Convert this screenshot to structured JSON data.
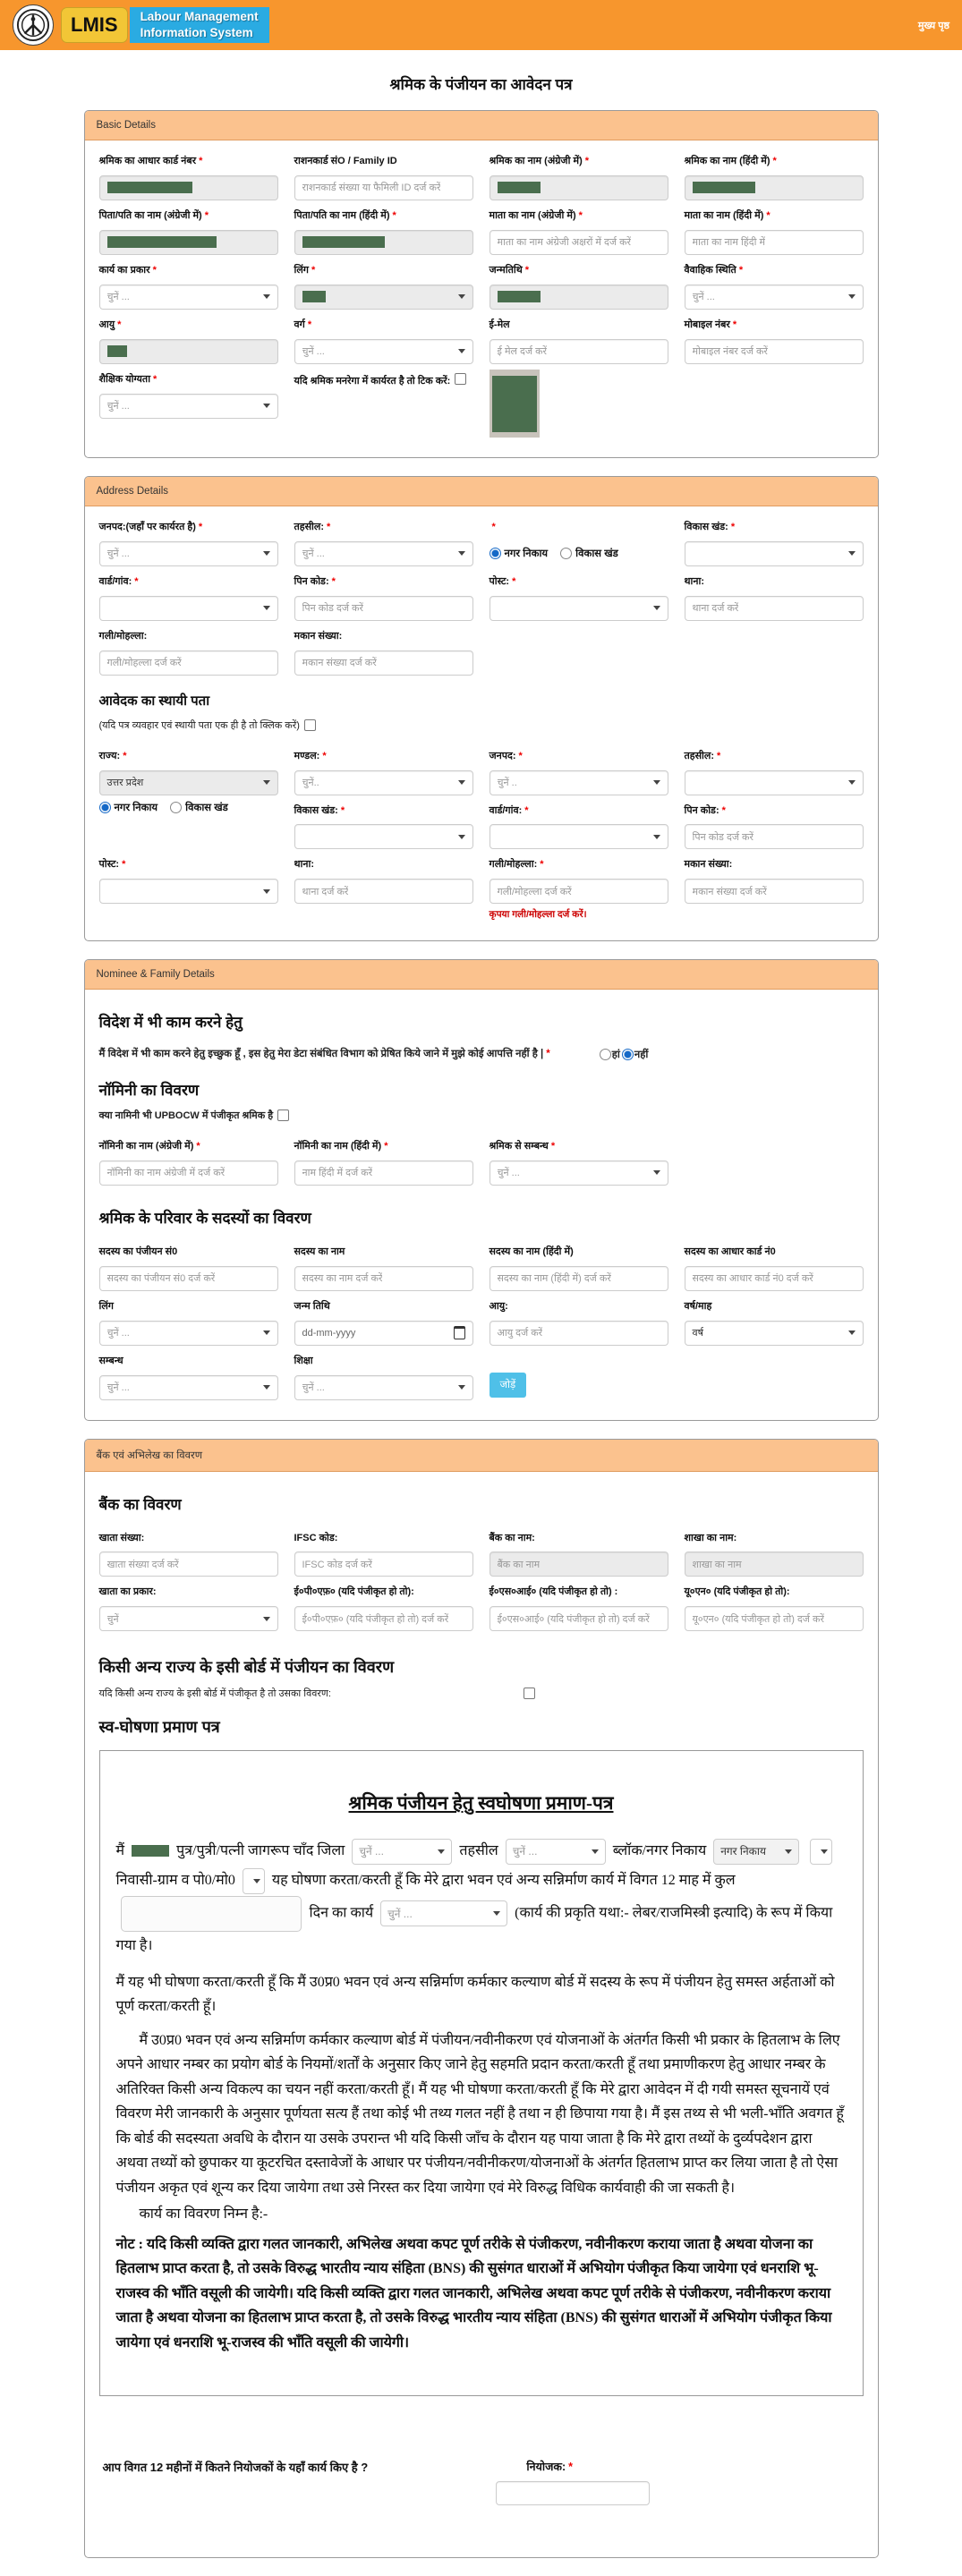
{
  "header": {
    "logo_text": "LMIS",
    "app_line1": "Labour Management",
    "app_line2": "Information System",
    "home_link": "मुख्य पृष्ठ",
    "header_color": "#F7962D",
    "banner_blue": "#2AABE2",
    "badge_yellow": "#F2C636"
  },
  "page_title": "श्रमिक के पंजीयन का आवेदन पत्र",
  "theme": {
    "section_header_bg": "#FBC28E",
    "redaction_green": "#4A6E4E",
    "add_button_blue": "#4FC0E8",
    "error_red": "#cc0000"
  },
  "basic": {
    "title": "Basic Details",
    "rows": [
      [
        {
          "name": "aadhaar-number",
          "label": "श्रमिक का आधार कार्ड नंबर",
          "required": true,
          "kind": "filled",
          "redact_w": 95
        },
        {
          "name": "ration-card",
          "label": "राशनकार्ड संO / Family ID",
          "kind": "input",
          "placeholder": "राशनकार्ड संख्या या फैमिली ID दर्ज करें"
        },
        {
          "name": "worker-name-en",
          "label": "श्रमिक का नाम (अंग्रेजी में)",
          "required": true,
          "kind": "filled",
          "redact_w": 48
        },
        {
          "name": "worker-name-hi",
          "label": "श्रमिक का नाम (हिंदी में)",
          "required": true,
          "kind": "filled",
          "redact_w": 70
        }
      ],
      [
        {
          "name": "father-husband-name-en",
          "label": "पिता/पति का नाम (अंग्रेजी में)",
          "required": true,
          "kind": "filled",
          "redact_w": 122
        },
        {
          "name": "father-husband-name-hi",
          "label": "पिता/पति का नाम (हिंदी में)",
          "required": true,
          "kind": "filled",
          "redact_w": 92
        },
        {
          "name": "mother-name-en",
          "label": "माता का नाम (अंग्रेजी में)",
          "required": true,
          "kind": "input",
          "placeholder": "माता का नाम अंग्रेजी अक्षरों में दर्ज करें"
        },
        {
          "name": "mother-name-hi",
          "label": "माता का नाम (हिंदी में)",
          "required": true,
          "kind": "input",
          "placeholder": "माता का नाम हिंदी में"
        }
      ],
      [
        {
          "name": "work-type",
          "label": "कार्य का प्रकार",
          "required": true,
          "kind": "select",
          "value": "चुनें ...",
          "muted": true
        },
        {
          "name": "gender",
          "label": "लिंग",
          "required": true,
          "kind": "select-redacted",
          "redact_w": 26
        },
        {
          "name": "dob",
          "label": "जन्मतिथि",
          "required": true,
          "kind": "filled",
          "redact_w": 48
        },
        {
          "name": "marital-status",
          "label": "वैवाहिक स्थिति",
          "required": true,
          "kind": "select",
          "value": "चुनें ...",
          "muted": true
        }
      ],
      [
        {
          "name": "age",
          "label": "आयु",
          "required": true,
          "kind": "filled",
          "redact_w": 22
        },
        {
          "name": "category",
          "label": "वर्ग",
          "required": true,
          "kind": "select",
          "value": "चुनें ...",
          "muted": true
        },
        {
          "name": "email",
          "label": "ई-मेल",
          "kind": "input",
          "placeholder": "ई मेल दर्ज करें"
        },
        {
          "name": "mobile-number",
          "label": "मोबाइल नंबर",
          "required": true,
          "kind": "input",
          "placeholder": "मोबाइल नंबर दर्ज करें"
        }
      ],
      [
        {
          "name": "education",
          "label": "शैक्षिक योग्यता",
          "required": true,
          "kind": "select",
          "value": "चुनें ...",
          "muted": true
        },
        {
          "name": "mnrega-tick",
          "kind": "checktext",
          "text": "यदि श्रमिक मनरेगा में कार्यरत है तो टिक करें:"
        },
        {
          "name": "worker-photo",
          "kind": "photo"
        },
        {}
      ]
    ]
  },
  "address": {
    "title": "Address Details",
    "rows": [
      [
        {
          "name": "district-working",
          "label": "जनपद:(जहाँ पर कार्यरत है)",
          "required": true,
          "kind": "select",
          "value": "चुनें ...",
          "muted": true
        },
        {
          "name": "tehsil",
          "label": "तहसील:",
          "required": true,
          "kind": "select",
          "value": "चुनें ...",
          "muted": true
        },
        {
          "name": "body-type",
          "label": "",
          "required": true,
          "kind": "radios",
          "options": [
            {
              "name": "nagar-nikay",
              "label": "नगर निकाय",
              "checked": true
            },
            {
              "name": "vikas-khand",
              "label": "विकास खंड",
              "checked": false
            }
          ]
        },
        {
          "name": "vikas-khand",
          "label": "विकास खंड:",
          "required": true,
          "kind": "select",
          "value": ""
        }
      ],
      [
        {
          "name": "ward-village",
          "label": "वार्ड/गांव:",
          "required": true,
          "kind": "select",
          "value": ""
        },
        {
          "name": "pin-code",
          "label": "पिन कोड:",
          "required": true,
          "kind": "input",
          "placeholder": "पिन कोड दर्ज करें"
        },
        {
          "name": "post",
          "label": "पोस्ट:",
          "required": true,
          "kind": "select",
          "value": ""
        },
        {
          "name": "police-station",
          "label": "थाना:",
          "kind": "input",
          "placeholder": "थाना दर्ज करें"
        }
      ],
      [
        {
          "name": "street-mohalla",
          "label": "गली/मोहल्ला:",
          "kind": "input",
          "placeholder": "गली/मोहल्ला दर्ज करें"
        },
        {
          "name": "house-number",
          "label": "मकान संख्या:",
          "kind": "input",
          "placeholder": "मकान संख्या दर्ज करें"
        },
        {},
        {}
      ]
    ],
    "perm_heading": "आवेदक का स्थायी पता",
    "perm_note": "(यदि पत्र व्यवहार एवं स्थायी पता एक ही है तो क्लिक करें)",
    "perm_rows": [
      [
        {
          "name": "perm-state",
          "label": "राज्य:",
          "required": true,
          "kind": "select",
          "value": "उत्तर प्रदेश",
          "disabled": true
        },
        {
          "name": "perm-mandal",
          "label": "मण्डल:",
          "required": true,
          "kind": "select",
          "value": "चुनें..",
          "muted": true
        },
        {
          "name": "perm-district",
          "label": "जनपद:",
          "required": true,
          "kind": "select",
          "value": "चुनें ..",
          "muted": true
        },
        {
          "name": "perm-tehsil",
          "label": "तहसील:",
          "required": true,
          "kind": "select",
          "value": ""
        }
      ],
      [
        {
          "name": "perm-body-type",
          "kind": "radios",
          "options": [
            {
              "name": "perm-nagar-nikay",
              "label": "नगर निकाय",
              "checked": true
            },
            {
              "name": "perm-vikas-khand",
              "label": "विकास खंड",
              "checked": false
            }
          ]
        },
        {
          "name": "perm-vikas-khand",
          "label": "विकास खंड:",
          "required": true,
          "kind": "select",
          "value": ""
        },
        {
          "name": "perm-ward-village",
          "label": "वार्ड/गांव:",
          "required": true,
          "kind": "select",
          "value": ""
        },
        {
          "name": "perm-pin-code",
          "label": "पिन कोड:",
          "required": true,
          "kind": "input",
          "placeholder": "पिन कोड दर्ज करें"
        }
      ],
      [
        {
          "name": "perm-post",
          "label": "पोस्ट:",
          "required": true,
          "kind": "select",
          "value": ""
        },
        {
          "name": "perm-police-station",
          "label": "थाना:",
          "kind": "input",
          "placeholder": "थाना दर्ज करें"
        },
        {
          "name": "perm-street-mohalla",
          "label": "गली/मोहल्ला:",
          "required": true,
          "kind": "input",
          "placeholder": "गली/मोहल्ला दर्ज करें",
          "error": "कृपया गली/मोहल्ला दर्ज करें।"
        },
        {
          "name": "perm-house-number",
          "label": "मकान संख्या:",
          "kind": "input",
          "placeholder": "मकान संख्या दर्ज करें"
        }
      ]
    ]
  },
  "nominee": {
    "title": "Nominee & Family Details",
    "foreign_heading": "विदेश में भी काम करने हेतु",
    "foreign_text": "मैं विदेश में भी काम करने हेतु इच्छुक हूँ , इस हेतु मेरा डेटा संबंधित विभाग को प्रेषित किये जाने में मुझे कोई आपत्ति नहीं है |",
    "consent_yes": "हां",
    "consent_no": "नहीं",
    "nominee_heading": "नॉमिनी का विवरण",
    "upbocw_note": "क्या नामिनी भी UPBOCW में पंजीकृत श्रमिक है",
    "rows": [
      [
        {
          "name": "nominee-name-en",
          "label": "नॉमिनी का नाम (अंग्रेजी में)",
          "required": true,
          "kind": "input",
          "placeholder": "नॉमिनी का नाम अंग्रेजी में दर्ज करें"
        },
        {
          "name": "nominee-name-hi",
          "label": "नॉमिनी का नाम (हिंदी में)",
          "required": true,
          "kind": "input",
          "placeholder": "नाम हिंदी में दर्ज करें"
        },
        {
          "name": "relation-with-worker",
          "label": "श्रमिक से सम्बन्ध",
          "required": true,
          "kind": "select",
          "value": "चुनें ...",
          "muted": true
        },
        {}
      ]
    ],
    "family_heading": "श्रमिक के परिवार के सदस्यों का विवरण",
    "family_rows": [
      [
        {
          "name": "member-reg-no",
          "label": "सदस्य का पंजीयन सं0",
          "kind": "input",
          "placeholder": "सदस्य का पंजीयन सं0 दर्ज करें"
        },
        {
          "name": "member-name",
          "label": "सदस्य का नाम",
          "kind": "input",
          "placeholder": "सदस्य का नाम दर्ज करें"
        },
        {
          "name": "member-name-hi",
          "label": "सदस्य का नाम (हिंदी में)",
          "kind": "input",
          "placeholder": "सदस्य का नाम (हिंदी में) दर्ज करें"
        },
        {
          "name": "member-aadhaar",
          "label": "सदस्य का आधार कार्ड नं0",
          "kind": "input",
          "placeholder": "सदस्य का आधार कार्ड नं0 दर्ज करें"
        }
      ],
      [
        {
          "name": "member-gender",
          "label": "लिंग",
          "kind": "select",
          "value": "चुनें ...",
          "muted": true
        },
        {
          "name": "member-dob",
          "label": "जन्म तिथि",
          "kind": "date",
          "value": "dd-mm-yyyy"
        },
        {
          "name": "member-age",
          "label": "आयु:",
          "kind": "input",
          "placeholder": "आयु दर्ज करें"
        },
        {
          "name": "member-year-month",
          "label": "वर्ष/माह",
          "kind": "select",
          "value": "वर्ष"
        }
      ],
      [
        {
          "name": "member-relation",
          "label": "सम्बन्ध",
          "kind": "select",
          "value": "चुनें ...",
          "muted": true
        },
        {
          "name": "member-education",
          "label": "शिक्षा",
          "kind": "select",
          "value": "चुनें ...",
          "muted": true
        },
        {
          "name": "add-member-button",
          "label": "",
          "kind": "button",
          "value": "जोड़ें"
        },
        {}
      ]
    ]
  },
  "bank": {
    "title": "बैंक एवं अभिलेख का विवरण",
    "bank_heading": "बैंक का विवरण",
    "rows": [
      [
        {
          "name": "account-number",
          "label": "खाता संख्या:",
          "kind": "input",
          "placeholder": "खाता संख्या दर्ज करें"
        },
        {
          "name": "ifsc-code",
          "label": "IFSC कोड:",
          "kind": "input",
          "placeholder": "IFSC कोड दर्ज करें"
        },
        {
          "name": "bank-name",
          "label": "बैंक का नाम:",
          "kind": "input",
          "placeholder": "बैंक का नाम",
          "disabled": true
        },
        {
          "name": "branch-name",
          "label": "शाखा का नाम:",
          "kind": "input",
          "placeholder": "शाखा का नाम",
          "disabled": true
        }
      ],
      [
        {
          "name": "account-type",
          "label": "खाता का प्रकार:",
          "kind": "select",
          "value": "चुनें",
          "muted": true
        },
        {
          "name": "epf-number",
          "label": "ई०पी०एफ़० (यदि पंजीकृत हो तो):",
          "kind": "input",
          "placeholder": "ई०पी०एफ़० (यदि पंजीकृत हो तो) दर्ज करें"
        },
        {
          "name": "esi-number",
          "label": "ई०एस०आई० (यदि पंजीकृत हो तो) :",
          "kind": "input",
          "placeholder": "ई०एस०आई० (यदि पंजीकृत हो तो) दर्ज करें"
        },
        {
          "name": "un-number",
          "label": "यू०एन० (यदि पंजीकृत हो तो):",
          "kind": "input",
          "placeholder": "यू०एन० (यदि पंजीकृत हो तो) दर्ज करें"
        }
      ]
    ],
    "other_state_heading": "किसी अन्य राज्य के इसी बोर्ड में पंजीयन का विवरण",
    "other_state_note": "यदि किसी अन्य राज्य के इसी बोर्ड में पंजीकृत है तो उसका विवरण:",
    "self_decl_heading": "स्व-घोषणा प्रमाण पत्र"
  },
  "decl": {
    "title": "श्रमिक पंजीयन हेतु स्वघोषणा प्रमाण-पत्र",
    "s1": "मैं",
    "s2": "पुत्र/पुत्री/पत्नी जागरूप चाँद जिला",
    "s3": "तहसील",
    "s4": "ब्लॉक/नगर निकाय",
    "block_value": "नगर निकाय",
    "s5": "निवासी-ग्राम व पो0/मो0",
    "s6": "यह घोषणा करता/करती हूँ कि मेरे द्वारा भवन एवं अन्य सन्निर्माण कार्य में विगत 12 माह में कुल",
    "s7": "दिन का कार्य",
    "s8": "(कार्य की प्रकृति यथा:- लेबर/राजमिस्त्री इत्यादि) के रूप में किया गया है।",
    "choose": "चुनें ...",
    "p1": "मैं यह भी घोषणा करता/करती हूँ कि मैं उ0प्र0 भवन एवं अन्य सन्निर्माण कर्मकार कल्याण बोर्ड में सदस्य के रूप में पंजीयन हेतु समस्त अर्हताओं को पूर्ण करता/करती हूँ।",
    "p2": "मैं उ0प्र0 भवन एवं अन्य सन्निर्माण कर्मकार कल्याण बोर्ड में पंजीयन/नवीनीकरण एवं योजनाओं के अंतर्गत किसी भी प्रकार के हितलाभ के लिए अपने आधार नम्बर का प्रयोग बोर्ड के नियमों/शर्तों के अनुसार किए जाने हेतु सहमति प्रदान करता/करती हूँ तथा प्रमाणीकरण हेतु आधार नम्बर के अतिरिक्त किसी अन्य विकल्प का चयन नहीं करता/करती हूँ। मैं यह भी घोषणा करता/करती हूँ कि मेरे द्वारा आवेदन में दी गयी समस्त सूचनायें एवं विवरण मेरी जानकारी के अनुसार पूर्णयता सत्य हैं तथा कोई भी तथ्य गलत नहीं है तथा न ही छिपाया गया है। मैं इस तथ्य से भी भली-भाँति अवगत हूँ कि बोर्ड की सदस्यता अवधि के दौरान या उसके उपरान्त भी यदि किसी जाँच के दौरान यह पाया जाता है कि मेरे द्वारा तथ्यों के दुर्व्यपदेशन द्वारा अथवा तथ्यों को छुपाकर या कूटरचित दस्तावेजों के आधार पर पंजीयन/नवीनीकरण/योजनाओं के अंतर्गत हितलाभ प्राप्त कर लिया जाता है तो ऐसा पंजीयन अकृत एवं शून्य कर दिया जायेगा तथा उसे निरस्त कर दिया जायेगा एवं मेरे विरुद्ध विधिक कार्यवाही की जा सकती है।",
    "p3": "कार्य का विवरण निम्न है:-",
    "note": "नोट : यदि किसी व्यक्ति द्वारा गलत जानकारी, अभिलेख अथवा कपट पूर्ण तरीके से पंजीकरण, नवीनीकरण कराया जाता है अथवा योजना का हितलाभ प्राप्त करता है, तो उसके विरुद्ध भारतीय न्याय संहिता (BNS) की सुसंगत धाराओं में अभियोग पंजीकृत किया जायेगा एवं धनराशि भू-राजस्व की भाँति वसूली की जायेगी। यदि किसी व्यक्ति द्वारा गलत जानकारी, अभिलेख अथवा कपट पूर्ण तरीके से पंजीकरण, नवीनीकरण कराया जाता है अथवा योजना का हितलाभ प्राप्त करता है, तो उसके विरुद्ध भारतीय न्याय संहिता (BNS) की सुसंगत धाराओं में अभियोग पंजीकृत किया जायेगा एवं धनराशि भू-राजस्व की भाँति वसूली की जायेगी।",
    "employer_question": "आप विगत 12 महीनों में कितने नियोजकों के यहाँ कार्य किए है ?",
    "employer_label": "नियोजक:"
  }
}
